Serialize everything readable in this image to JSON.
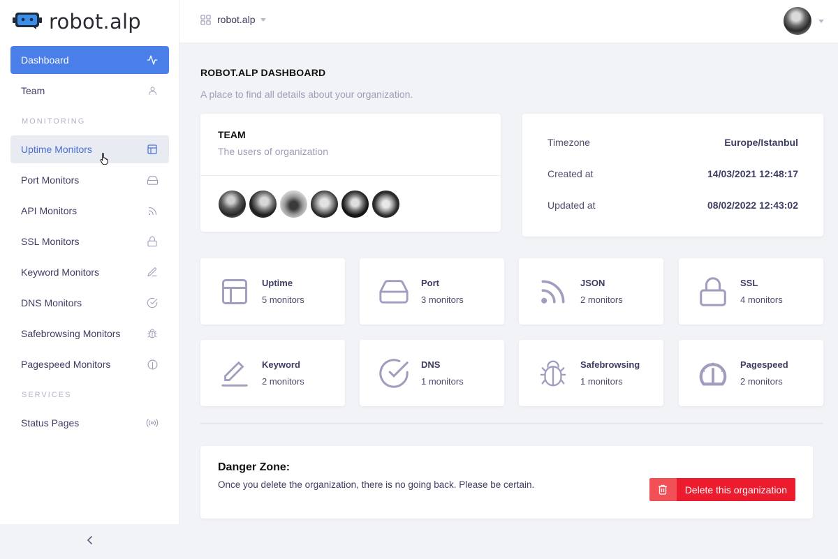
{
  "app": {
    "name": "robot.alp",
    "accent_color": "#4a7ee8",
    "danger_color": "#ec1c2e"
  },
  "sidebar": {
    "items": [
      {
        "label": "Dashboard",
        "icon": "activity-icon",
        "state": "active"
      },
      {
        "label": "Team",
        "icon": "user-icon"
      }
    ],
    "sections": [
      {
        "title": "MONITORING",
        "items": [
          {
            "label": "Uptime Monitors",
            "icon": "layout-icon",
            "state": "hover"
          },
          {
            "label": "Port Monitors",
            "icon": "hard-drive-icon"
          },
          {
            "label": "API Monitors",
            "icon": "rss-icon"
          },
          {
            "label": "SSL Monitors",
            "icon": "lock-icon"
          },
          {
            "label": "Keyword Monitors",
            "icon": "pencil-icon"
          },
          {
            "label": "DNS Monitors",
            "icon": "check-circle-icon"
          },
          {
            "label": "Safebrowsing Monitors",
            "icon": "bug-icon"
          },
          {
            "label": "Pagespeed Monitors",
            "icon": "gauge-icon"
          }
        ]
      },
      {
        "title": "SERVICES",
        "items": [
          {
            "label": "Status Pages",
            "icon": "broadcast-icon"
          }
        ]
      }
    ],
    "collapse_icon": "chevron-left-icon"
  },
  "topbar": {
    "org_name": "robot.alp",
    "org_icon": "grid-icon"
  },
  "page": {
    "title": "ROBOT.ALP DASHBOARD",
    "subtitle": "A place to find all details about your organization."
  },
  "team_card": {
    "title": "TEAM",
    "subtitle": "The users of organization",
    "member_count": 6
  },
  "info_card": {
    "rows": [
      {
        "label": "Timezone",
        "value": "Europe/Istanbul"
      },
      {
        "label": "Created at",
        "value": "14/03/2021 12:48:17"
      },
      {
        "label": "Updated at",
        "value": "08/02/2022 12:43:02"
      }
    ]
  },
  "stats": [
    {
      "name": "Uptime",
      "count": "5 monitors",
      "icon": "layout-icon"
    },
    {
      "name": "Port",
      "count": "3 monitors",
      "icon": "hard-drive-icon"
    },
    {
      "name": "JSON",
      "count": "2 monitors",
      "icon": "rss-icon"
    },
    {
      "name": "SSL",
      "count": "4 monitors",
      "icon": "lock-icon"
    },
    {
      "name": "Keyword",
      "count": "2 monitors",
      "icon": "pencil-icon"
    },
    {
      "name": "DNS",
      "count": "1 monitors",
      "icon": "check-circle-icon"
    },
    {
      "name": "Safebrowsing",
      "count": "1 monitors",
      "icon": "bug-icon"
    },
    {
      "name": "Pagespeed",
      "count": "2 monitors",
      "icon": "gauge-icon"
    }
  ],
  "danger_zone": {
    "title": "Danger Zone:",
    "text": "Once you delete the organization, there is no going back. Please be certain.",
    "button_label": "Delete this organization",
    "button_icon": "trash-icon"
  }
}
